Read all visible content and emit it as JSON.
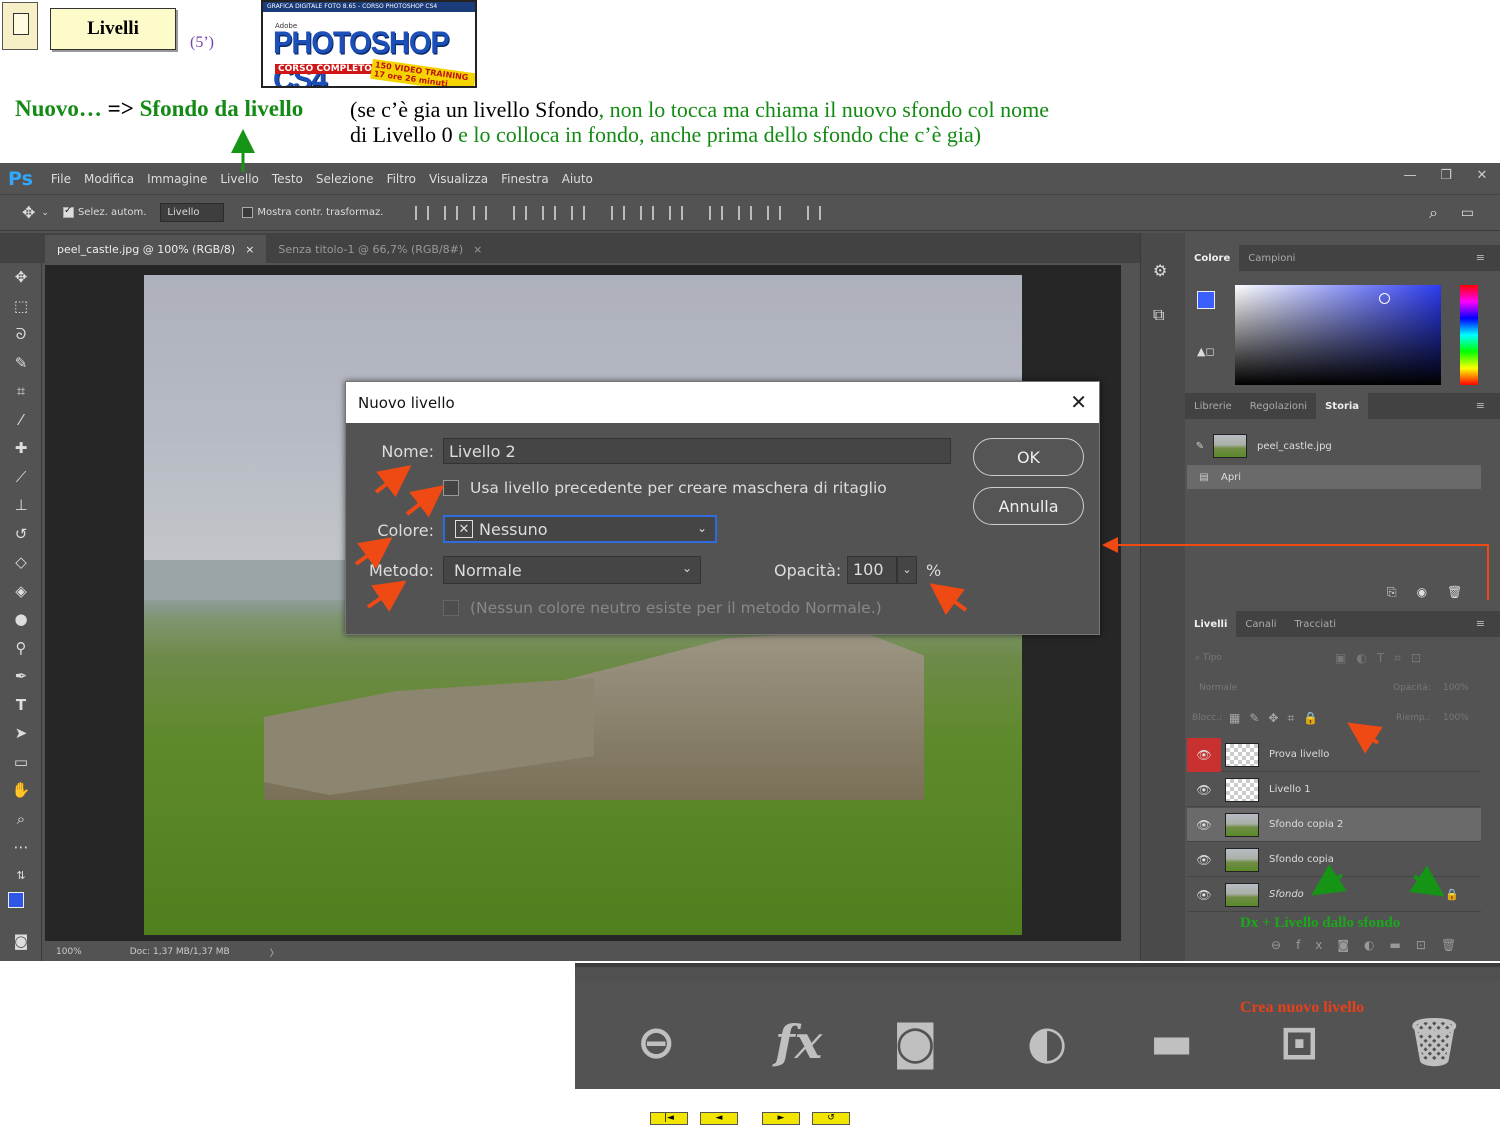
{
  "slide": {
    "title": "Livelli",
    "duration": "(5’)",
    "logo": {
      "band_text": "GRAFICA DIGITALE FOTO 8.65 - CORSO PHOTOSHOP CS4",
      "adobe": "Adobe",
      "product": "PHOTOSHOP CS4",
      "corso": "CORSO COMPLETO",
      "video": "150 VIDEO TRAINING 17 ore 26 minuti"
    },
    "heading": {
      "part1": "Nuovo…",
      "part2": " => ",
      "part3": "Sfondo da livello"
    },
    "note_line1": {
      "a": "(se c’è gia un livello Sfondo",
      "b": ", non lo tocca ma chiama il nuovo sfondo col nome"
    },
    "note_line2": {
      "a": "di Livello 0",
      "b": " e lo colloca in fondo, anche prima dello sfondo che c’è gia)"
    },
    "ds_note": "Dx + Livello dallo sfondo",
    "crea_note": "Crea nuovo livello",
    "nav": [
      "|◄",
      "◄",
      "►",
      "↺"
    ]
  },
  "ps": {
    "logo": "Ps",
    "menu": [
      "File",
      "Modifica",
      "Immagine",
      "Livello",
      "Testo",
      "Selezione",
      "Filtro",
      "Visualizza",
      "Finestra",
      "Aiuto"
    ],
    "options": {
      "auto_select": "Selez. autom.",
      "auto_select_target": "Livello",
      "show_transform": "Mostra contr. trasformaz."
    },
    "tabs": [
      {
        "label": "peel_castle.jpg @ 100% (RGB/8)",
        "close": "×"
      },
      {
        "label": "Senza titolo-1 @ 66,7% (RGB/8#)",
        "close": "×"
      }
    ],
    "status": {
      "zoom": "100%",
      "doc": "Doc: 1,37 MB/1,37 MB",
      "arrow": "〉"
    },
    "color_panel": {
      "tabs": [
        "Colore",
        "Campioni"
      ]
    },
    "history_panel": {
      "tabs": [
        "Librerie",
        "Regolazioni",
        "Storia"
      ],
      "snapshot": "peel_castle.jpg",
      "items": [
        "Apri"
      ]
    },
    "layers_panel": {
      "tabs": [
        "Livelli",
        "Canali",
        "Tracciati"
      ],
      "filter_placeholder": "Tipo",
      "blend": "Normale",
      "opacity_label": "Opacità:",
      "opacity_value": "100%",
      "lock_label": "Blocc.:",
      "fill_label": "Riemp.:",
      "fill_value": "100%",
      "layers": [
        {
          "name": "Prova livello",
          "thumb": "transparent"
        },
        {
          "name": "Livello 1",
          "thumb": "transparent"
        },
        {
          "name": "Sfondo copia 2",
          "thumb": "photo"
        },
        {
          "name": "Sfondo copia",
          "thumb": "photo"
        },
        {
          "name": "Sfondo",
          "thumb": "photo"
        }
      ]
    }
  },
  "dialog": {
    "title": "Nuovo livello",
    "close": "✕",
    "name_label": "Nome:",
    "name_value": "Livello 2",
    "clip_label": "Usa livello precedente per creare maschera di ritaglio",
    "color_label": "Colore:",
    "color_value": "Nessuno",
    "mode_label": "Metodo:",
    "mode_value": "Normale",
    "opacity_label": "Opacità:",
    "opacity_value": "100",
    "percent": "%",
    "neutral_label": "(Nessun colore neutro esiste per il metodo Normale.)",
    "ok": "OK",
    "cancel": "Annulla"
  }
}
